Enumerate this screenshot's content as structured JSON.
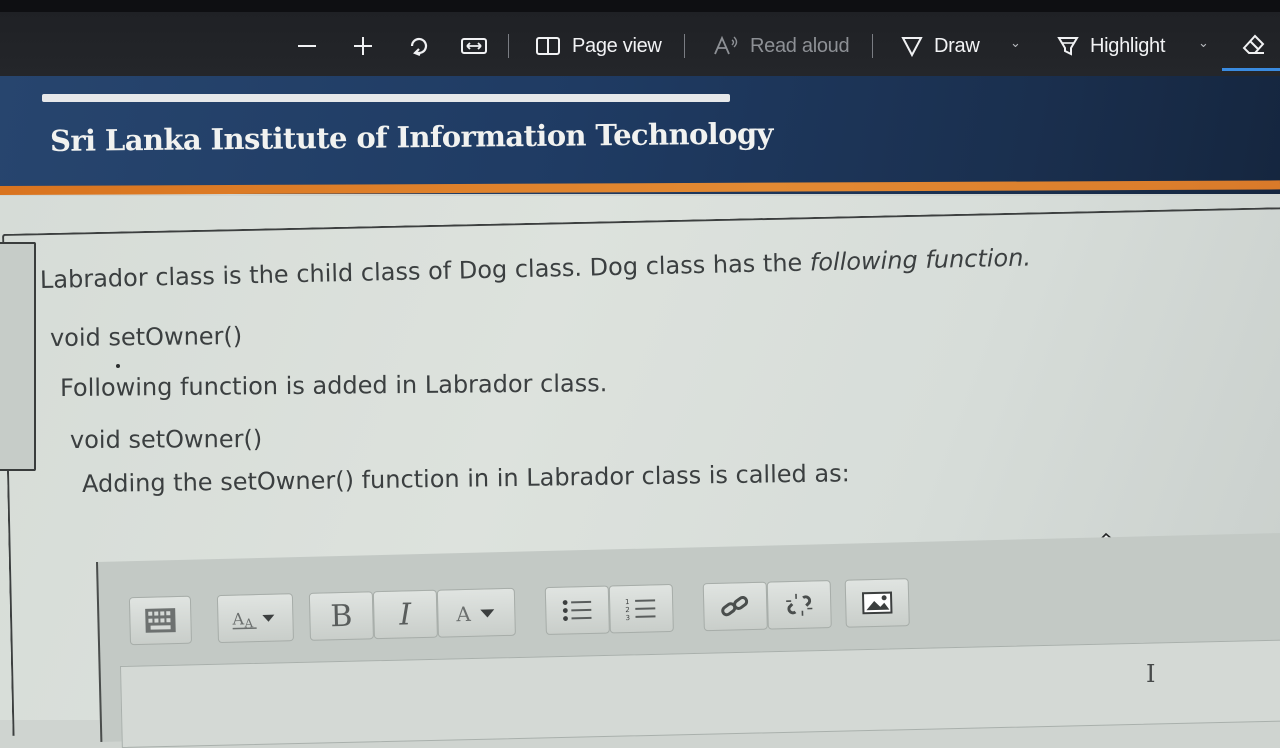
{
  "toolbar": {
    "zoom_out_icon": "minus-icon",
    "zoom_in_icon": "plus-icon",
    "rotate_icon": "rotate-icon",
    "fit_icon": "fit-width-icon",
    "page_view_label": "Page view",
    "read_aloud_label": "Read aloud",
    "draw_label": "Draw",
    "highlight_label": "Highlight",
    "eraser_icon": "eraser-icon"
  },
  "header": {
    "institution": "Sri Lanka Institute of Information Technology"
  },
  "question": {
    "line1_regular": "Labrador class is the child class of Dog class. Dog class has the ",
    "line1_italic": "following function.",
    "line2": "void setOwner()",
    "line3": "Following function is added in Labrador class.",
    "line4": "void setOwner()",
    "line5": "Adding the setOwner() function in in Labrador class is called as:"
  },
  "editor": {
    "buttons": [
      {
        "name": "toolbar-toggle-button",
        "icon": "keyboard-icon"
      },
      {
        "name": "font-size-button",
        "icon": "font-size-icon"
      },
      {
        "name": "bold-button",
        "label": "B"
      },
      {
        "name": "italic-button",
        "label": "I"
      },
      {
        "name": "text-color-button",
        "icon": "text-color-icon"
      },
      {
        "name": "bullet-list-button",
        "icon": "bullet-list-icon"
      },
      {
        "name": "numbered-list-button",
        "icon": "numbered-list-icon"
      },
      {
        "name": "link-button",
        "icon": "link-icon"
      },
      {
        "name": "unlink-button",
        "icon": "unlink-icon"
      },
      {
        "name": "image-button",
        "icon": "image-icon"
      }
    ],
    "bold_label": "B",
    "italic_label": "I"
  }
}
